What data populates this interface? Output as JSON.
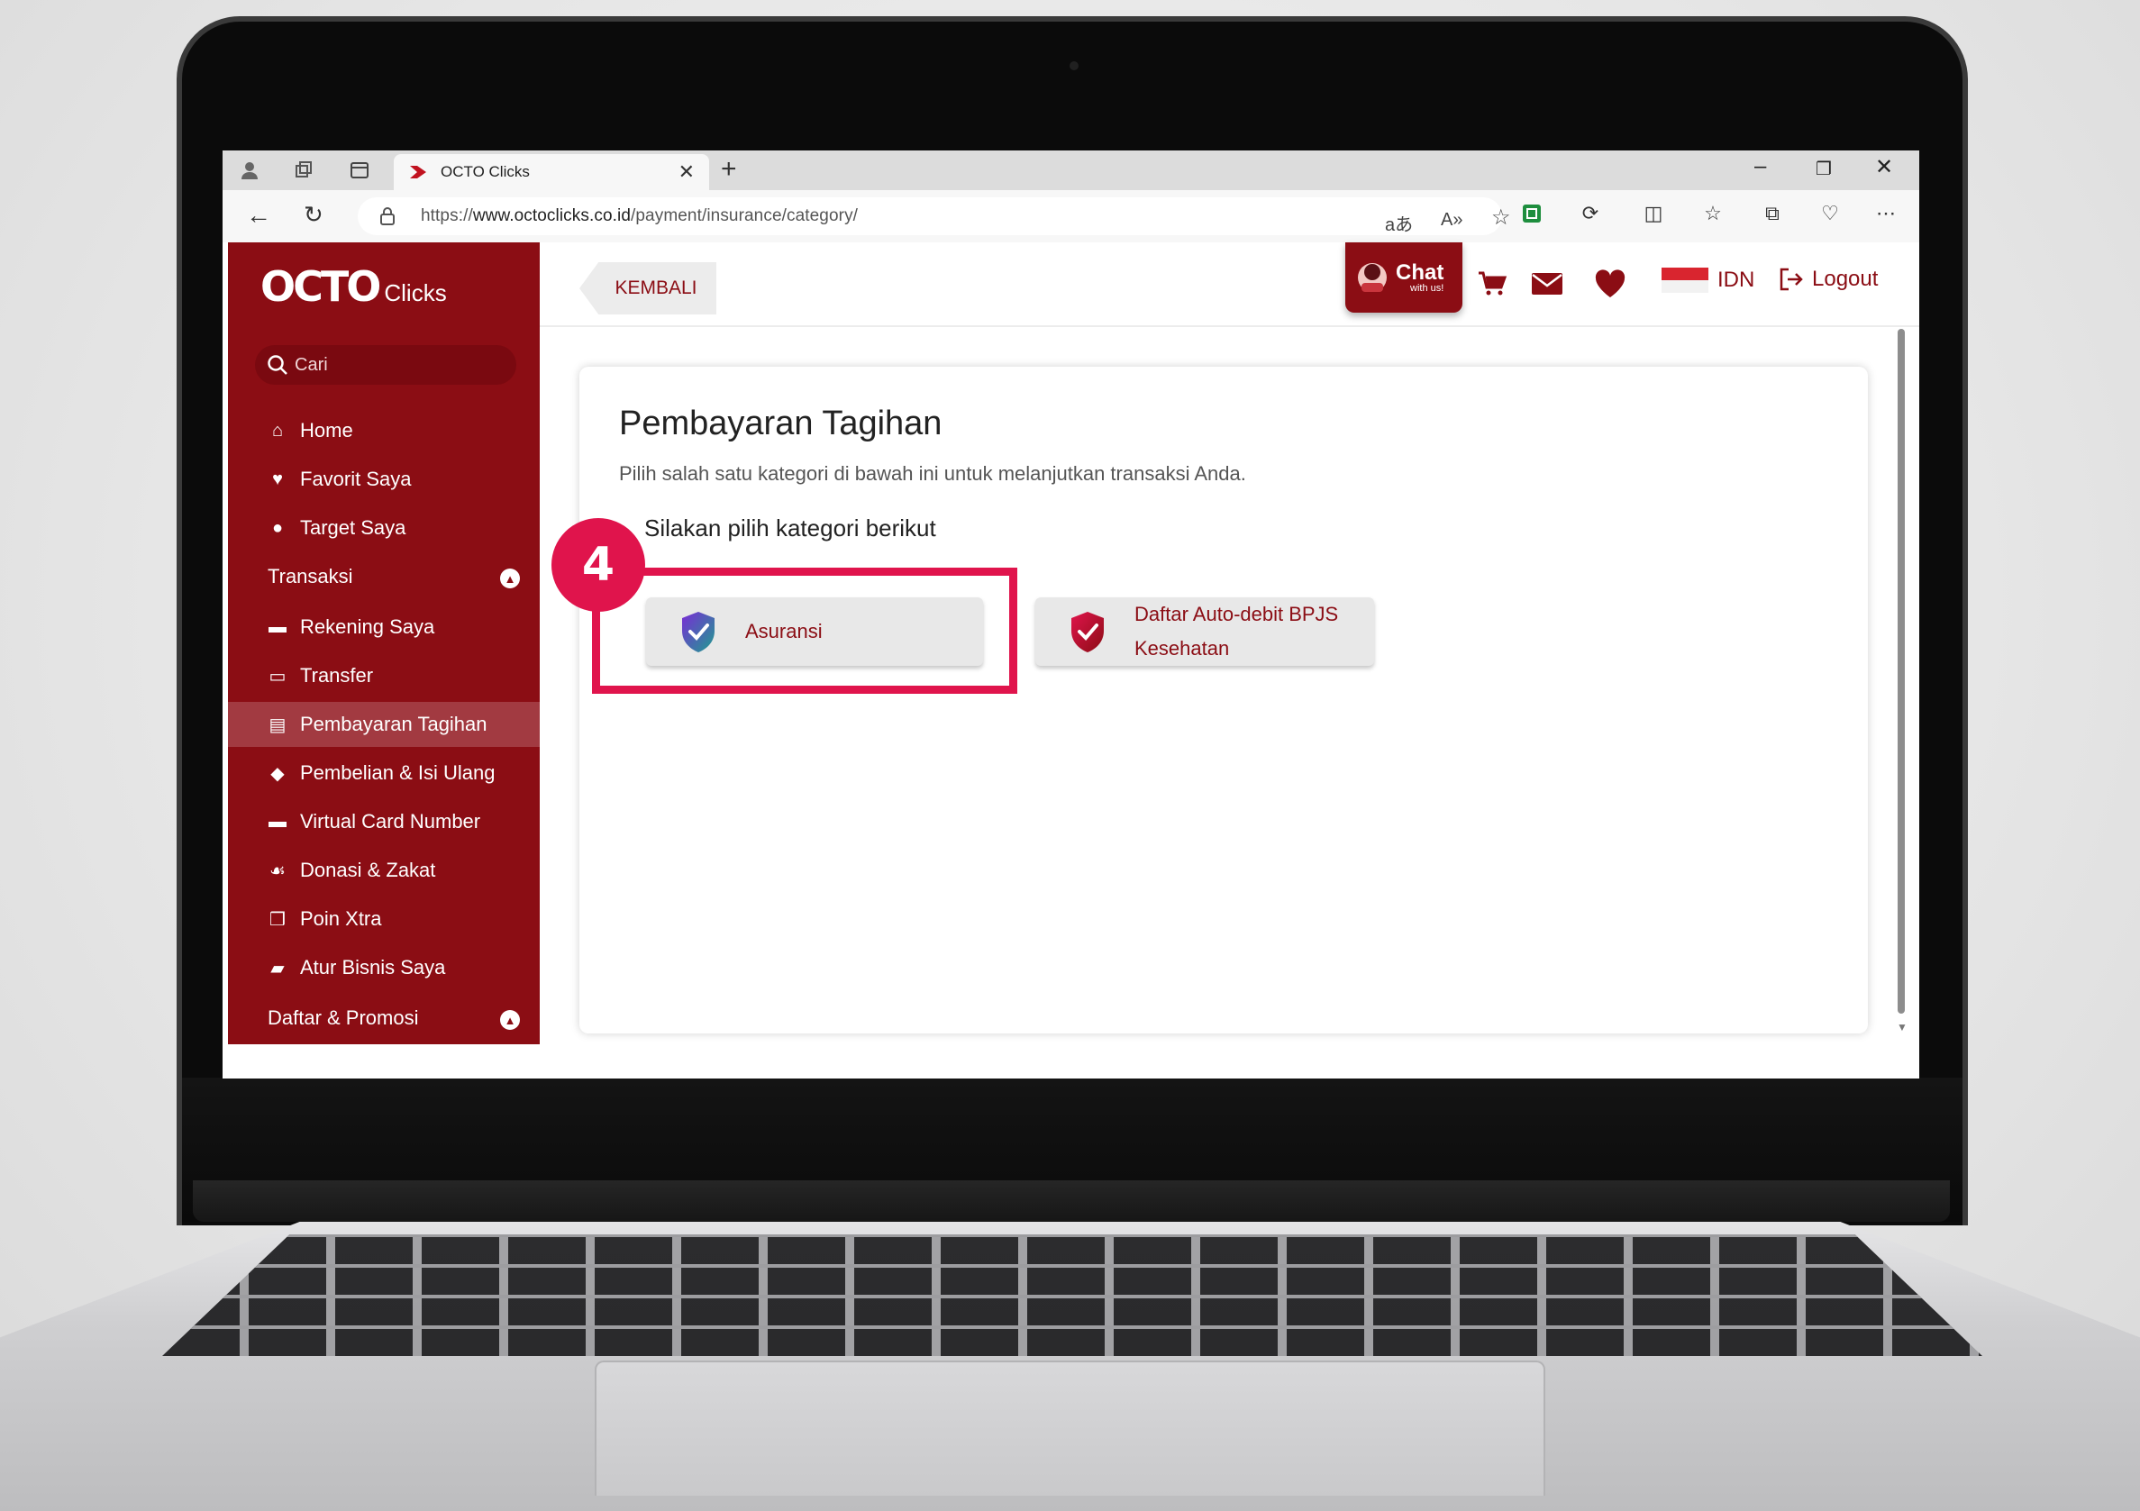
{
  "browser": {
    "tab_title": "OCTO Clicks",
    "url_prefix": "https://",
    "url_domain": "www.octoclicks.co.id",
    "url_path": "/payment/insurance/category/"
  },
  "sidebar": {
    "logo_main": "OCTO",
    "logo_sub": "Clicks",
    "search_placeholder": "Cari",
    "items": [
      {
        "label": "Home",
        "icon": "home-icon"
      },
      {
        "label": "Favorit Saya",
        "icon": "heart-icon"
      },
      {
        "label": "Target Saya",
        "icon": "location-pin-icon"
      },
      {
        "label": "Transaksi",
        "icon": "chevron-up-icon"
      },
      {
        "label": "Rekening Saya",
        "icon": "wallet-icon"
      },
      {
        "label": "Transfer",
        "icon": "transfer-icon"
      },
      {
        "label": "Pembayaran Tagihan",
        "icon": "bill-icon"
      },
      {
        "label": "Pembelian & Isi Ulang",
        "icon": "tag-icon"
      },
      {
        "label": "Virtual Card Number",
        "icon": "card-icon"
      },
      {
        "label": "Donasi & Zakat",
        "icon": "donation-icon"
      },
      {
        "label": "Poin Xtra",
        "icon": "gift-icon"
      },
      {
        "label": "Atur Bisnis Saya",
        "icon": "briefcase-icon"
      },
      {
        "label": "Daftar & Promosi",
        "icon": "chevron-up-icon"
      }
    ]
  },
  "header": {
    "back_label": "KEMBALI",
    "chat_main": "Chat",
    "chat_sub": "with us!",
    "language": "IDN",
    "logout_label": "Logout"
  },
  "content": {
    "title": "Pembayaran Tagihan",
    "subtitle": "Pilih salah satu kategori di bawah ini untuk melanjutkan transaksi Anda.",
    "prompt": "Silakan pilih kategori berikut",
    "categories": [
      {
        "label": "Asuransi",
        "icon": "shield-check-icon"
      },
      {
        "label_line1": "Daftar Auto-debit BPJS",
        "label_line2": "Kesehatan",
        "icon": "shield-check-icon"
      }
    ]
  },
  "annotation": {
    "step_number": "4"
  },
  "colors": {
    "brand": "#8b0d14",
    "highlight": "#e0144c",
    "sidebar_active": "#a23a41"
  }
}
